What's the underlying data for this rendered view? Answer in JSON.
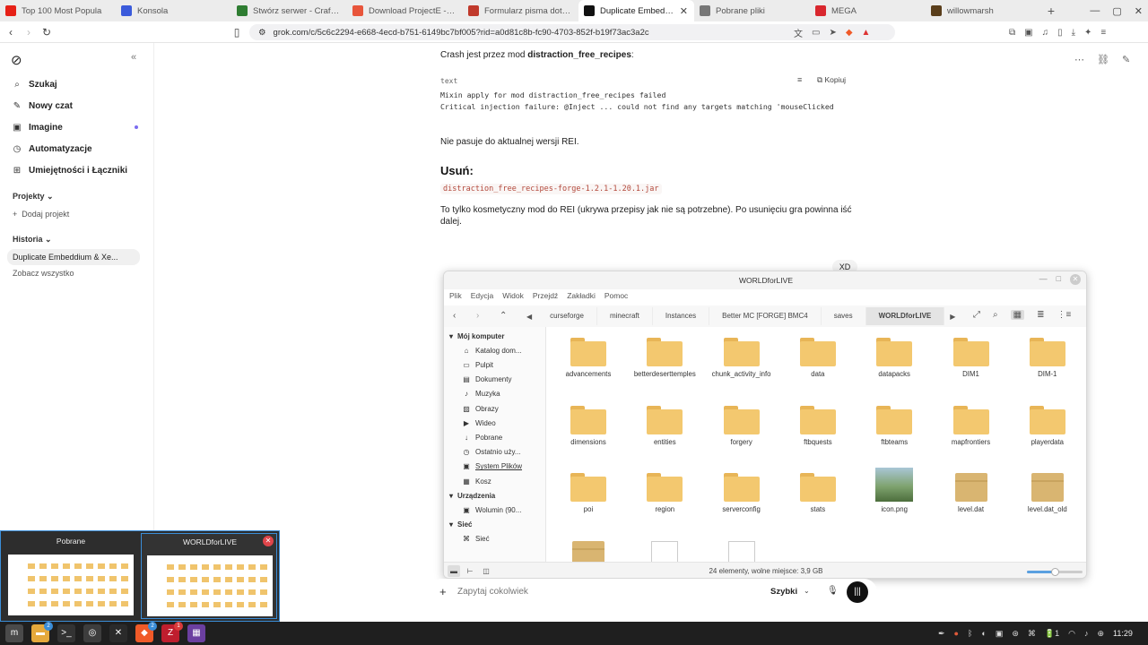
{
  "browser": {
    "tabs": [
      {
        "label": "Top 100 Most Popula",
        "icon_color": "#e62117"
      },
      {
        "label": "Konsola",
        "icon_color": "#3b5bdb"
      },
      {
        "label": "Stwórz serwer - Craftse",
        "icon_color": "#2f7d32"
      },
      {
        "label": "Download ProjectE - Mi",
        "icon_color": "#e8553b"
      },
      {
        "label": "Formularz pisma dotycz",
        "icon_color": "#c0392b"
      },
      {
        "label": "Duplicate Embeddiu",
        "icon_color": "#111111",
        "active": true
      },
      {
        "label": "Pobrane pliki",
        "icon_color": "#777777"
      },
      {
        "label": "MEGA",
        "icon_color": "#d9272e"
      },
      {
        "label": "willowmarsh",
        "icon_color": "#5a3e1b"
      }
    ],
    "url": "grok.com/c/5c6c2294-e668-4ecd-b751-6149bc7bf005?rid=a0d81c8b-fc90-4703-852f-b19f73ac3a2c"
  },
  "sidebar": {
    "items": [
      {
        "label": "Szukaj",
        "icon": "search-icon",
        "glyph": "⌕"
      },
      {
        "label": "Nowy czat",
        "icon": "chat-icon",
        "glyph": "✎"
      },
      {
        "label": "Imagine",
        "icon": "image-icon",
        "glyph": "▣"
      },
      {
        "label": "Automatyzacje",
        "icon": "clock-icon",
        "glyph": "◷"
      },
      {
        "label": "Umiejętności i Łączniki",
        "icon": "grid-icon",
        "glyph": "⊞"
      }
    ],
    "projects_label": "Projekty",
    "add_project": "Dodaj projekt",
    "history_label": "Historia",
    "history_items": [
      "Duplicate Embeddium & Xe..."
    ],
    "see_all": "Zobacz wszystko"
  },
  "chat": {
    "crash_prefix": "Crash jest przez mod ",
    "crash_mod": "distraction_free_recipes",
    "crash_suffix": ":",
    "code": {
      "lang": "text",
      "copy_label": "Kopiuj",
      "lines": [
        "Mixin apply for mod distraction_free_recipes failed",
        "Critical injection failure: @Inject ... could not find any targets matching 'mouseClicked"
      ]
    },
    "mismatch": "Nie pasuje do aktualnej wersji REI.",
    "remove_heading": "Usuń:",
    "jar": "distraction_free_recipes-forge-1.2.1-1.20.1.jar",
    "explain": "To tylko kosmetyczny mod do REI (ukrywa przepisy jak nie są potrzebne). Po usunięciu gra powinna iść dalej.",
    "user_msg": "XD",
    "input_placeholder": "Zapytaj cokolwiek",
    "mode": "Szybki"
  },
  "filemanager": {
    "title": "WORLDforLIVE",
    "menu": [
      "Plik",
      "Edycja",
      "Widok",
      "Przejdź",
      "Zakładki",
      "Pomoc"
    ],
    "breadcrumbs": [
      "curseforge",
      "minecraft",
      "Instances",
      "Better MC [FORGE] BMC4",
      "saves",
      "WORLDforLIVE"
    ],
    "sidebar": {
      "computer_label": "Mój komputer",
      "computer_items": [
        {
          "label": "Katalog dom...",
          "icon": "home-icon",
          "glyph": "⌂"
        },
        {
          "label": "Pulpit",
          "icon": "desktop-icon",
          "glyph": "▭"
        },
        {
          "label": "Dokumenty",
          "icon": "documents-icon",
          "glyph": "▤"
        },
        {
          "label": "Muzyka",
          "icon": "music-icon",
          "glyph": "♪"
        },
        {
          "label": "Obrazy",
          "icon": "pictures-icon",
          "glyph": "▨"
        },
        {
          "label": "Wideo",
          "icon": "video-icon",
          "glyph": "▶"
        },
        {
          "label": "Pobrane",
          "icon": "download-icon",
          "glyph": "↓"
        },
        {
          "label": "Ostatnio uży...",
          "icon": "recent-icon",
          "glyph": "◷"
        },
        {
          "label": "System Plików",
          "icon": "drive-icon",
          "glyph": "▣"
        },
        {
          "label": "Kosz",
          "icon": "trash-icon",
          "glyph": "▦"
        }
      ],
      "devices_label": "Urządzenia",
      "devices_items": [
        {
          "label": "Wolumin (90...",
          "icon": "drive-icon",
          "glyph": "▣"
        }
      ],
      "network_label": "Sieć",
      "network_items": [
        {
          "label": "Sieć",
          "icon": "network-icon",
          "glyph": "⌘"
        }
      ]
    },
    "items": [
      {
        "name": "advancements",
        "type": "folder"
      },
      {
        "name": "betterdeserttemples",
        "type": "folder"
      },
      {
        "name": "chunk_activity_info",
        "type": "folder"
      },
      {
        "name": "data",
        "type": "folder"
      },
      {
        "name": "datapacks",
        "type": "folder"
      },
      {
        "name": "DIM1",
        "type": "folder"
      },
      {
        "name": "DIM-1",
        "type": "folder"
      },
      {
        "name": "dimensions",
        "type": "folder"
      },
      {
        "name": "entities",
        "type": "folder"
      },
      {
        "name": "forgery",
        "type": "folder"
      },
      {
        "name": "ftbquests",
        "type": "folder"
      },
      {
        "name": "ftbteams",
        "type": "folder"
      },
      {
        "name": "mapfrontiers",
        "type": "folder"
      },
      {
        "name": "playerdata",
        "type": "folder"
      },
      {
        "name": "poi",
        "type": "folder"
      },
      {
        "name": "region",
        "type": "folder"
      },
      {
        "name": "serverconfig",
        "type": "folder"
      },
      {
        "name": "stats",
        "type": "folder"
      },
      {
        "name": "icon.png",
        "type": "image"
      },
      {
        "name": "level.dat",
        "type": "dat"
      },
      {
        "name": "level.dat_old",
        "type": "dat"
      },
      {
        "name": "",
        "type": "dat"
      },
      {
        "name": "",
        "type": "doc"
      },
      {
        "name": "",
        "type": "doc"
      }
    ],
    "status": "24 elementy, wolne miejsce: 3,9 GB",
    "zoom_fraction": 0.5
  },
  "switcher": {
    "windows": [
      "Pobrane",
      "WORLDforLIVE"
    ]
  },
  "taskbar": {
    "apps": [
      {
        "name": "menu",
        "color": "#4a4a4a",
        "glyph": "m"
      },
      {
        "name": "files",
        "color": "#e5a93c",
        "glyph": "▬",
        "badge": "2"
      },
      {
        "name": "terminal",
        "color": "#333333",
        "glyph": ">_"
      },
      {
        "name": "settings",
        "color": "#3d3d3d",
        "glyph": "◎"
      },
      {
        "name": "xmrig",
        "color": "#2a2a2a",
        "glyph": "✕"
      },
      {
        "name": "brave",
        "color": "#f05a28",
        "glyph": "◆",
        "badge": "2"
      },
      {
        "name": "filezilla",
        "color": "#bf1e2e",
        "glyph": "Z",
        "badge": "1",
        "badge_red": true
      },
      {
        "name": "game",
        "color": "#6b3fa0",
        "glyph": "▦"
      }
    ],
    "battery": "1",
    "time": "11:29"
  }
}
